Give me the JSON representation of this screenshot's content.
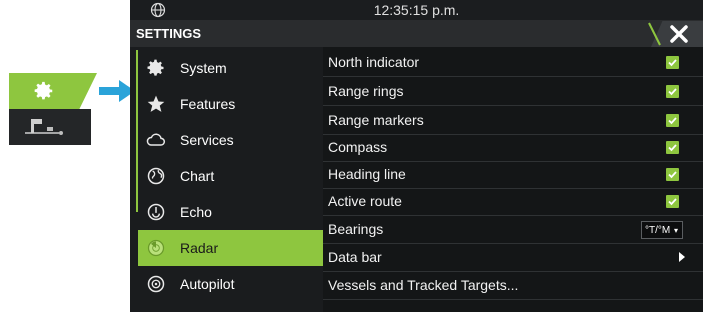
{
  "statusbar": {
    "time": "12:35:15 p.m."
  },
  "settings": {
    "title": "SETTINGS"
  },
  "sidebar": {
    "items": [
      {
        "label": "System",
        "icon": "gear-icon"
      },
      {
        "label": "Features",
        "icon": "star-icon"
      },
      {
        "label": "Services",
        "icon": "cloud-icon"
      },
      {
        "label": "Chart",
        "icon": "globe-icon"
      },
      {
        "label": "Echo",
        "icon": "echo-icon"
      },
      {
        "label": "Radar",
        "icon": "radar-icon",
        "active": true
      },
      {
        "label": "Autopilot",
        "icon": "autopilot-icon"
      }
    ]
  },
  "radar_settings": {
    "rows": [
      {
        "label": "North indicator",
        "control": "checkbox",
        "checked": true
      },
      {
        "label": "Range rings",
        "control": "checkbox",
        "checked": true
      },
      {
        "label": "Range markers",
        "control": "checkbox",
        "checked": true
      },
      {
        "label": "Compass",
        "control": "checkbox",
        "checked": true
      },
      {
        "label": "Heading line",
        "control": "checkbox",
        "checked": true
      },
      {
        "label": "Active route",
        "control": "checkbox",
        "checked": true
      },
      {
        "label": "Bearings",
        "control": "dropdown",
        "value": "°T/°M"
      },
      {
        "label": "Data bar",
        "control": "submenu"
      },
      {
        "label": "Vessels and Tracked Targets...",
        "control": "none"
      }
    ]
  },
  "colors": {
    "accent": "#8ec63f",
    "background": "#151718",
    "arrow": "#2aa3d9"
  }
}
